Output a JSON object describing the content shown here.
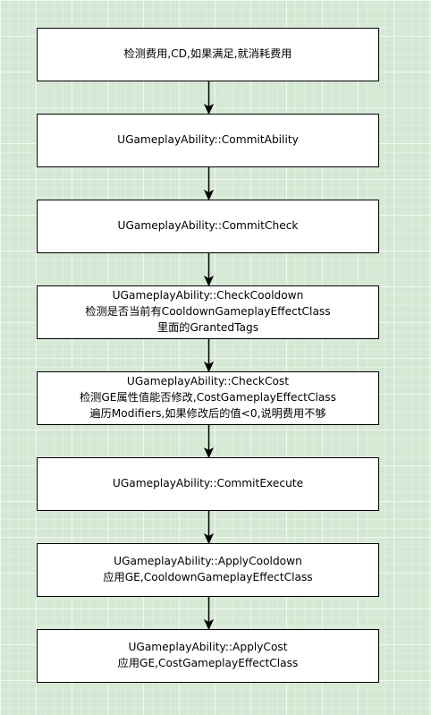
{
  "colors": {
    "background": "#d5e8d4",
    "grid": "#ffffff",
    "node_fill": "#ffffff",
    "node_border": "#000000",
    "edge": "#000000"
  },
  "nodes": [
    {
      "id": "check-cost-cd",
      "lines": [
        "检测费用,CD,如果满足,就消耗费用"
      ]
    },
    {
      "id": "commit-ability",
      "lines": [
        "UGameplayAbility::CommitAbility"
      ]
    },
    {
      "id": "commit-check",
      "lines": [
        "UGameplayAbility::CommitCheck"
      ]
    },
    {
      "id": "check-cooldown",
      "lines": [
        "UGameplayAbility::CheckCooldown",
        "检测是否当前有CooldownGameplayEffectClass",
        "里面的GrantedTags"
      ]
    },
    {
      "id": "check-cost",
      "lines": [
        "UGameplayAbility::CheckCost",
        "检测GE属性值能否修改,CostGameplayEffectClass",
        "遍历Modifiers,如果修改后的值<0,说明费用不够"
      ]
    },
    {
      "id": "commit-execute",
      "lines": [
        "UGameplayAbility::CommitExecute"
      ]
    },
    {
      "id": "apply-cooldown",
      "lines": [
        "UGameplayAbility::ApplyCooldown",
        "应用GE,CooldownGameplayEffectClass"
      ]
    },
    {
      "id": "apply-cost",
      "lines": [
        "UGameplayAbility::ApplyCost",
        "应用GE,CostGameplayEffectClass"
      ]
    }
  ],
  "edges": [
    {
      "from": 0,
      "to": 1
    },
    {
      "from": 1,
      "to": 2
    },
    {
      "from": 2,
      "to": 3
    },
    {
      "from": 3,
      "to": 4
    },
    {
      "from": 4,
      "to": 5
    },
    {
      "from": 5,
      "to": 6
    },
    {
      "from": 6,
      "to": 7
    }
  ]
}
